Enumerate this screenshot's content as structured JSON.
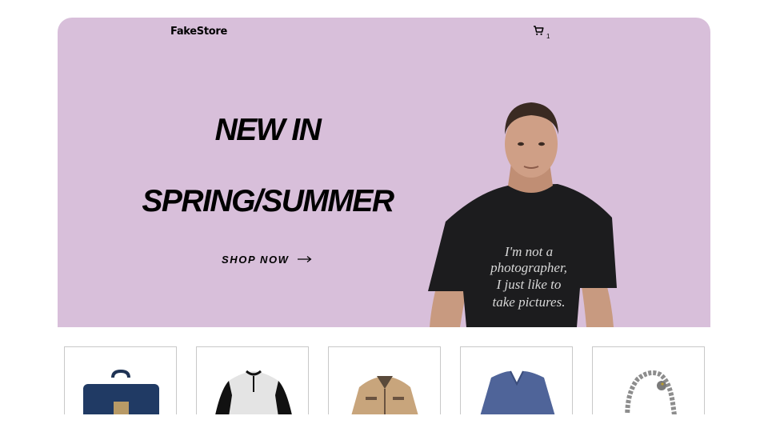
{
  "header": {
    "brand": "FakeStore",
    "cart_count": "1",
    "cart_icon": "cart-icon"
  },
  "hero": {
    "line1": "NEW IN",
    "line2": "SPRING/SUMMER",
    "cta_label": "SHOP NOW",
    "cta_icon": "arrow-right-icon",
    "background": "#d8bfda",
    "shirt_text": [
      "I'm not a",
      "photographer,",
      "I just like to",
      "take pictures."
    ]
  },
  "products": [
    {
      "kind": "backpack"
    },
    {
      "kind": "raglan-shirt"
    },
    {
      "kind": "jacket"
    },
    {
      "kind": "v-neck-shirt"
    },
    {
      "kind": "bracelet"
    }
  ]
}
